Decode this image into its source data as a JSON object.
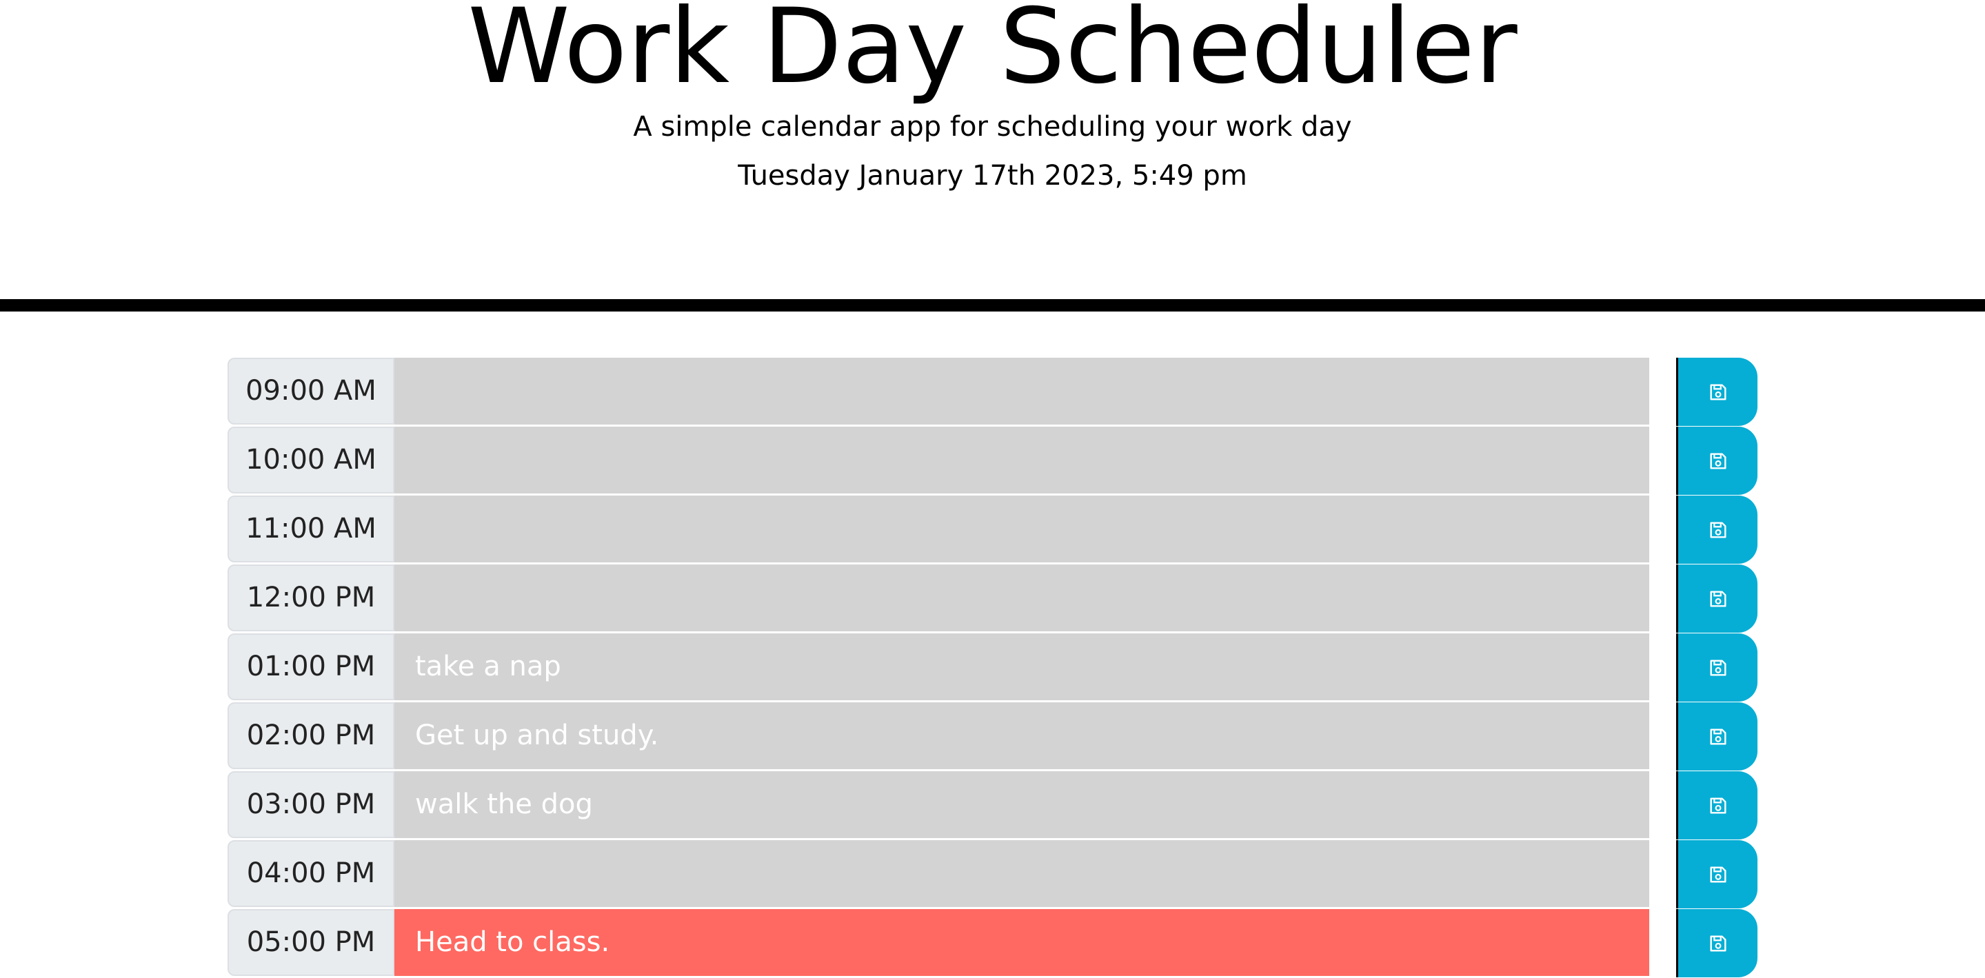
{
  "header": {
    "title": "Work Day Scheduler",
    "subtitle": "A simple calendar app for scheduling your work day",
    "current_day": "Tuesday January 17th 2023, 5:49 pm"
  },
  "colors": {
    "past": "#d3d3d3",
    "present": "#ff6961",
    "future": "#77dd77",
    "save_button": "#06aed5",
    "hour_bg": "#e9ecef"
  },
  "rows": [
    {
      "hour": "09:00 AM",
      "text": "",
      "state": "past"
    },
    {
      "hour": "10:00 AM",
      "text": "",
      "state": "past"
    },
    {
      "hour": "11:00 AM",
      "text": "",
      "state": "past"
    },
    {
      "hour": "12:00 PM",
      "text": "",
      "state": "past"
    },
    {
      "hour": "01:00 PM",
      "text": "take a nap",
      "state": "past"
    },
    {
      "hour": "02:00 PM",
      "text": "Get up and study.",
      "state": "past"
    },
    {
      "hour": "03:00 PM",
      "text": "walk the dog",
      "state": "past"
    },
    {
      "hour": "04:00 PM",
      "text": "",
      "state": "past"
    },
    {
      "hour": "05:00 PM",
      "text": "Head to class.",
      "state": "present"
    }
  ],
  "save_icon": "save-icon"
}
